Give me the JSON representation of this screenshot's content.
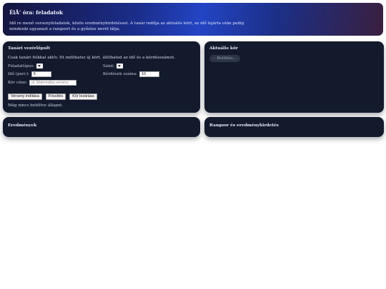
{
  "hero": {
    "title": "ÉlÅ‘ óra: feladatok",
    "description": "Idő re menő versenyfeladatok, közös eredményhirdetéssel. A tanár indítja az aktuális kört, az idő lejárta után pedig mindenki ugyanazt a rangsort és a győztes nevét látja."
  },
  "teacher": {
    "title": "Tanári vezérlőpult",
    "desc": "Csak tanári fiókkal aktív. Itt indíthatsz új kört, állíthatod az idő és a kérdésszámot.",
    "field_type_label": "Feladattípus:",
    "field_level_label": "Szint:",
    "field_time_label": "Idő (perc):",
    "field_time_value": "5",
    "field_count_label": "Kérdések száma:",
    "field_count_value": "10",
    "field_title_label": "Kör címe:",
    "field_title_placeholder": "pl. Matematika verseny",
    "buttons": [
      "Verseny indítása",
      "Frissítés",
      "Kör lezárása"
    ],
    "status": "Még nincs betöltve állapot."
  },
  "active": {
    "title": "Aktuális kör",
    "pill": "-- Betöltés..."
  },
  "results": {
    "title": "Eredmények"
  },
  "ranking": {
    "title": "Rangsor és eredményhirdetés"
  }
}
